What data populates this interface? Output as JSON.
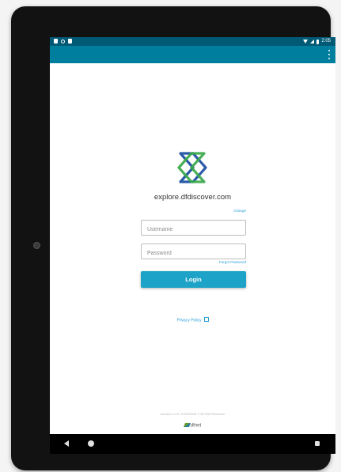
{
  "status_bar": {
    "time": "2:05",
    "icons": [
      "notification-icon",
      "sync-icon",
      "sd-card-icon",
      "wifi-icon",
      "signal-icon",
      "battery-icon"
    ]
  },
  "app_bar": {
    "menu_icon": "overflow-menu-icon"
  },
  "login": {
    "logo_icon": "dfdiscover-logo",
    "server_url": "explore.dfdiscover.com",
    "change_label": "Change",
    "username_placeholder": "Username",
    "username_value": "",
    "password_placeholder": "Password",
    "password_value": "",
    "forgot_password_label": "Forgot Password",
    "login_button_label": "Login",
    "privacy_policy_label": "Privacy Policy",
    "privacy_icon": "external-link-icon"
  },
  "footer": {
    "version_text": "Version 1.0.8, 2020/04/26 © DF/Net Research",
    "brand_text": "dfnet"
  },
  "nav_bar": {
    "icons": [
      "back-icon",
      "home-icon",
      "recents-icon"
    ]
  },
  "colors": {
    "status_bar": "#005a75",
    "app_bar": "#007e9e",
    "accent": "#1ca3c7",
    "link": "#2a9fd6",
    "logo_blue": "#2a5aa8",
    "logo_green": "#3aa84a"
  }
}
